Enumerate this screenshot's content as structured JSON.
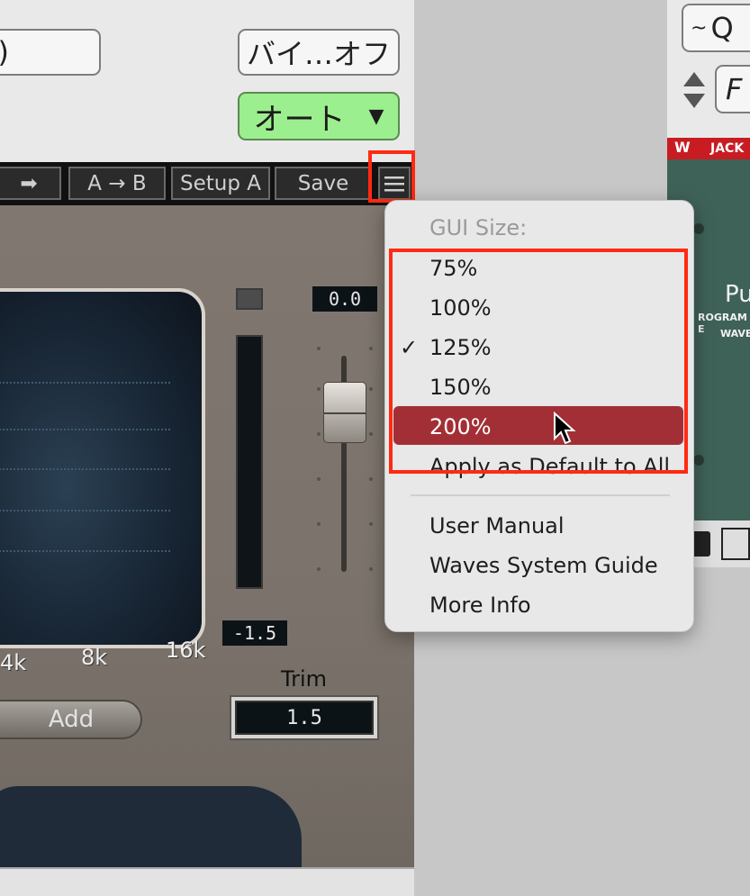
{
  "host": {
    "left_button_label": ")",
    "bypass_button_label": "バイ…オフ",
    "auto_dropdown_label": "オート",
    "auto_dropdown_arrow": "▼"
  },
  "toolbar": {
    "arrow_label": "➡",
    "ab_label": "A → B",
    "setup_label": "Setup A",
    "save_label": "Save",
    "menu_icon": "hamburger-icon"
  },
  "plugin": {
    "top_readout": "0.0",
    "bottom_readout": "-1.5",
    "freq_labels": [
      "4k",
      "8k",
      "16k"
    ],
    "add_button_label": "Add",
    "trim_label": "Trim",
    "trim_value": "1.5"
  },
  "right_panel": {
    "q_label": "Q",
    "f_label": "F",
    "jack_label": "JACK",
    "pu_label": "Pu",
    "program_label": "ROGRAM E",
    "waves_label": "WAVE"
  },
  "menu": {
    "header": "GUI Size:",
    "size_items": [
      "75%",
      "100%",
      "125%",
      "150%",
      "200%"
    ],
    "checked_item": "125%",
    "highlighted_item": "200%",
    "checkmark": "✓",
    "apply_default": "Apply as Default to All",
    "user_manual": "User Manual",
    "system_guide": "Waves System Guide",
    "more_info": "More Info"
  },
  "colors": {
    "highlight": "#a32f36",
    "annotation_red": "#ff2a12",
    "green_button": "#9cef8e",
    "jack_red": "#c81c22"
  }
}
